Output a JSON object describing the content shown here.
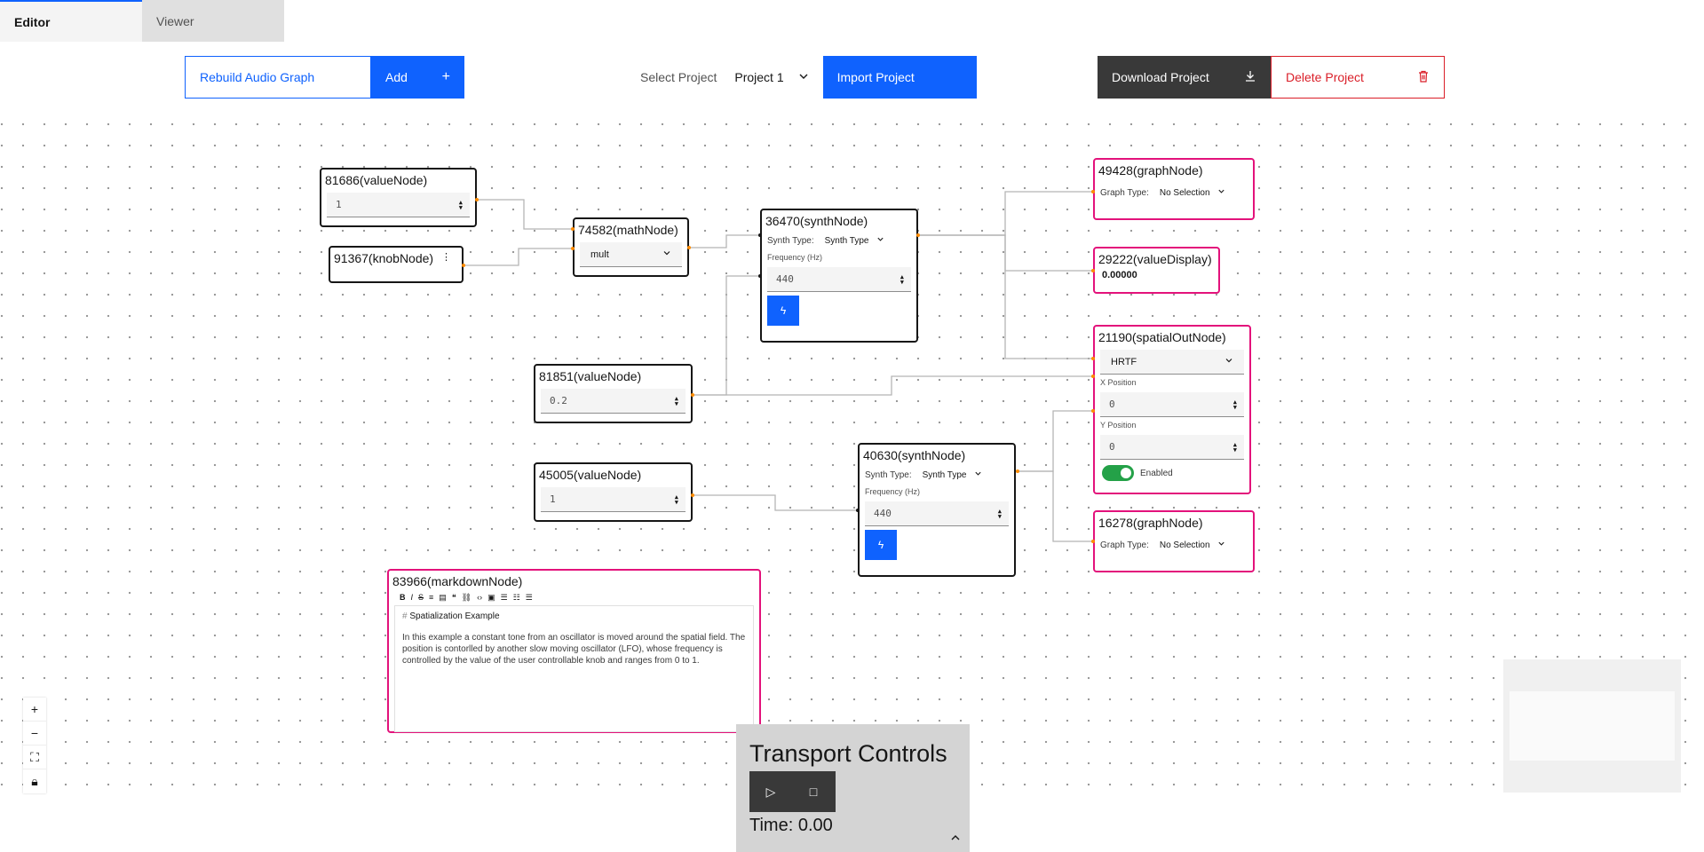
{
  "tabs": [
    {
      "label": "Editor"
    },
    {
      "label": "Viewer"
    }
  ],
  "toolbar": {
    "rebuild_label": "Rebuild Audio Graph",
    "add_label": "Add",
    "select_project_label": "Select Project",
    "project_value": "Project 1",
    "import_label": "Import Project",
    "download_label": "Download Project",
    "delete_label": "Delete Project"
  },
  "colors": {
    "accent": "#0f62fe",
    "danger": "#da1e28",
    "node_highlight": "#e3127b",
    "edge": "#b0b0b0"
  },
  "nodes": {
    "n81686": {
      "title": "81686(valueNode)",
      "value": "1"
    },
    "n91367": {
      "title": "91367(knobNode)"
    },
    "n74582": {
      "title": "74582(mathNode)",
      "operation": "mult"
    },
    "n36470": {
      "title": "36470(synthNode)",
      "synth_type_label": "Synth Type:",
      "synth_type_value": "Synth Type",
      "freq_label": "Frequency (Hz)",
      "freq_value": "440"
    },
    "n81851": {
      "title": "81851(valueNode)",
      "value": "0.2"
    },
    "n45005": {
      "title": "45005(valueNode)",
      "value": "1"
    },
    "n40630": {
      "title": "40630(synthNode)",
      "synth_type_label": "Synth Type:",
      "synth_type_value": "Synth Type",
      "freq_label": "Frequency (Hz)",
      "freq_value": "440"
    },
    "n49428": {
      "title": "49428(graphNode)",
      "graph_type_label": "Graph Type:",
      "graph_type_value": "No Selection"
    },
    "n29222": {
      "title": "29222(valueDisplay)",
      "value": "0.00000"
    },
    "n21190": {
      "title": "21190(spatialOutNode)",
      "mode": "HRTF",
      "x_label": "X Position",
      "x_value": "0",
      "y_label": "Y Position",
      "y_value": "0",
      "enabled_label": "Enabled"
    },
    "n16278": {
      "title": "16278(graphNode)",
      "graph_type_label": "Graph Type:",
      "graph_type_value": "No Selection"
    },
    "n83966": {
      "title": "83966(markdownNode)",
      "heading": "Spatialization Example",
      "heading_marker": "#",
      "body": "In this example a constant tone from an oscillator is moved around the spatial field. The position is contorlled by another slow moving oscillator (LFO), whose frequency is controlled by the value of the user controllable knob and ranges from 0 to 1."
    }
  },
  "transport": {
    "title": "Transport Controls",
    "time": "Time: 0.00"
  }
}
